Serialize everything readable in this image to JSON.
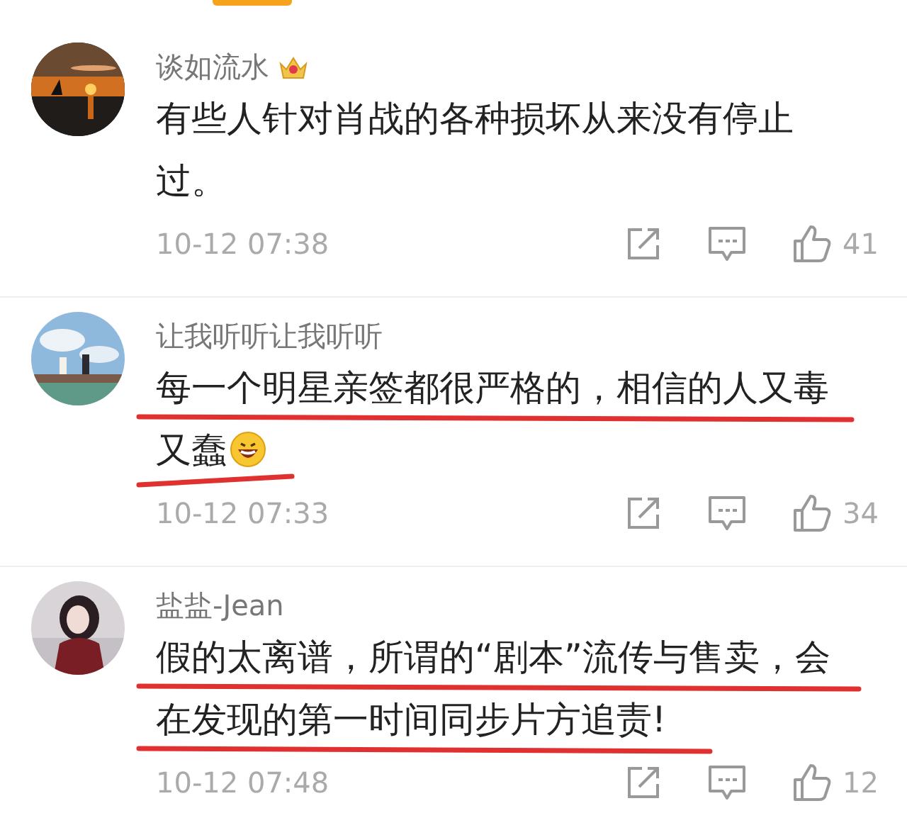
{
  "comments": [
    {
      "author": {
        "name": "谈如流水",
        "kind": "vip"
      },
      "lines": [
        {
          "text": "有些人针对肖战的各种损坏从来没有停止",
          "underlined": false
        },
        {
          "text": "过。",
          "underlined": false
        }
      ],
      "time": "10-12 07:38",
      "likes": "41"
    },
    {
      "author": {
        "name": "让我听听让我听听",
        "kind": "normal"
      },
      "lines": [
        {
          "text": "每一个明星亲签都很严格的，相信的人又毒",
          "underlined": true
        },
        {
          "text": "又蠢",
          "underlined": true,
          "emoji": true
        }
      ],
      "time": "10-12 07:33",
      "likes": "34"
    },
    {
      "author": {
        "name": "盐盐-Jean",
        "kind": "normal"
      },
      "lines": [
        {
          "text": "假的太离谱，所谓的“剧本”流传与售卖，会",
          "underlined": true
        },
        {
          "text": "在发现的第一时间同步片方追责!",
          "underlined": true
        }
      ],
      "time": "10-12 07:48",
      "likes": "12"
    }
  ]
}
